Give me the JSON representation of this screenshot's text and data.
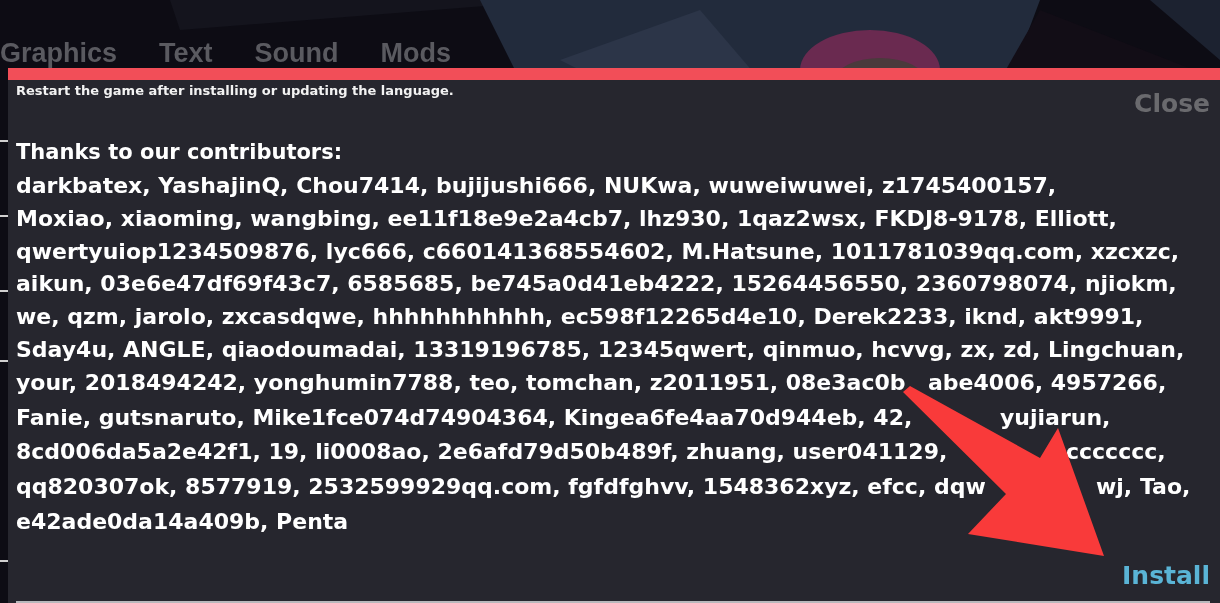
{
  "tabs": [
    {
      "label": "Graphics"
    },
    {
      "label": "Text"
    },
    {
      "label": "Sound"
    },
    {
      "label": "Mods"
    }
  ],
  "dialog": {
    "notice": "Restart the game after installing or updating the language.",
    "close_button": "Close",
    "heading": "Thanks to our contributors:",
    "lines": [
      {
        "segments": [
          "darkbatex, YashajinQ, Chou7414, bujijushi666, NUKwa, wuweiwuwei, z1745400157,"
        ]
      },
      {
        "segments": [
          "Moxiao, xiaoming, wangbing, ee11f18e9e2a4cb7, lhz930, 1qaz2wsx, FKDJ8-9178, Elliott,"
        ]
      },
      {
        "segments": [
          "qwertyuiop1234509876, lyc666, c660141368554602, M.Hatsune, 1011781039qq.com, xzcxzc,"
        ]
      },
      {
        "segments": [
          "aikun, 03e6e47df69f43c7, 6585685, be745a0d41eb4222, 15264456550, 2360798074, njiokm,"
        ]
      },
      {
        "segments": [
          "we, qzm, jarolo, zxcasdqwe, hhhhhhhhhhh, ec598f12265d4e10, Derek2233, iknd, akt9991,"
        ]
      },
      {
        "segments": [
          "Sday4u, ANGLE, qiaodoumadai, 13319196785, 12345qwert, qinmuo, hcvvg, zx, zd, Lingchuan,"
        ]
      },
      {
        "segments": [
          "your, 2018494242, yonghumin7788, teo, tomchan, z2011951, 08e3ac0b",
          "abe4006, 4957266,"
        ]
      },
      {
        "segments": [
          "Fanie, gutsnaruto, Mike1fce074d74904364, Kingea6fe4aa70d944eb, 42,",
          "yujiarun,"
        ]
      },
      {
        "segments": [
          "8cd006da5a2e42f1, 19, li0008ao, 2e6afd79d50b489f, zhuang, user041129,",
          "ccccccc,"
        ]
      },
      {
        "segments": [
          "qq820307ok, 8577919, 2532599929qq.com, fgfdfghvv, 1548362xyz, efcc, dqw",
          "wj, Tao,"
        ]
      },
      {
        "segments": [
          "e42ade0da14a409b, Penta"
        ]
      }
    ],
    "install_button": "Install"
  }
}
